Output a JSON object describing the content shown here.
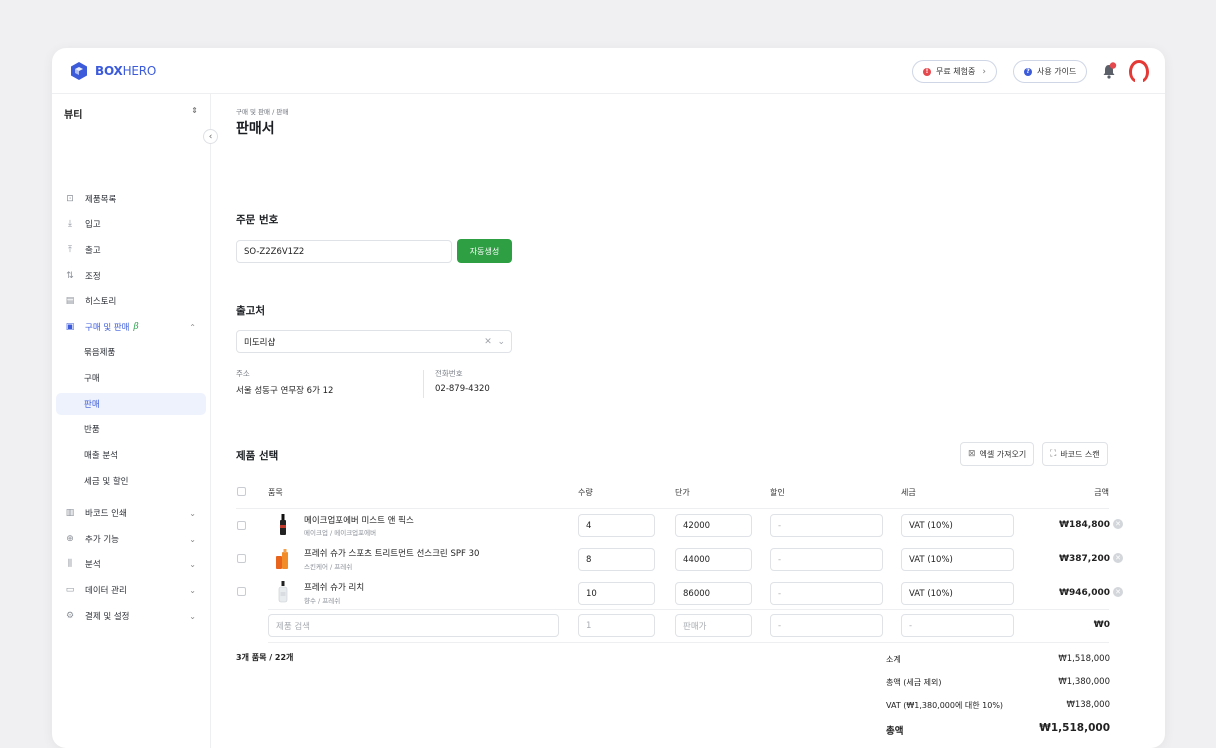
{
  "brand": {
    "name_bold": "BOX",
    "name_light": "HERO",
    "accent": "#3b5bdb"
  },
  "header": {
    "trial_label": "무료 체험중",
    "guide_label": "사용 가이드",
    "notif_count": "1"
  },
  "sidebar": {
    "workspace": "뷰티",
    "items": [
      {
        "label": "제품목록",
        "icon": "box-icon"
      },
      {
        "label": "입고",
        "icon": "arrow-down-icon"
      },
      {
        "label": "출고",
        "icon": "arrow-up-icon"
      },
      {
        "label": "조정",
        "icon": "swap-icon"
      },
      {
        "label": "히스토리",
        "icon": "history-icon"
      },
      {
        "label": "구매 및 판매",
        "icon": "document-icon",
        "beta": "β"
      }
    ],
    "sub_items": [
      "묶음제품",
      "구매",
      "판매",
      "반품",
      "매출 분석",
      "세금 및 할인"
    ],
    "groups": [
      {
        "label": "바코드 인쇄",
        "icon": "barcode-icon"
      },
      {
        "label": "추가 기능",
        "icon": "plus-circle-icon"
      },
      {
        "label": "분석",
        "icon": "chart-icon"
      },
      {
        "label": "데이터 관리",
        "icon": "database-icon"
      },
      {
        "label": "결제 및 설정",
        "icon": "settings-icon"
      }
    ]
  },
  "page": {
    "breadcrumb": "구매 및 판매 / 판매",
    "title": "판매서",
    "order_section": "주문 번호",
    "order_number": "SO-Z2Z6V1Z2",
    "auto_generate": "자동생성",
    "dest_section": "출고처",
    "destination": "미도리샵",
    "address_label": "주소",
    "address": "서울 성동구 연무장 6가 12",
    "phone_label": "전화번호",
    "phone": "02-879-4320",
    "product_section": "제품 선택",
    "excel_import": "엑셀 가져오기",
    "barcode_scan": "바코드 스캔"
  },
  "table": {
    "headers": {
      "item": "품목",
      "qty": "수량",
      "price": "단가",
      "discount": "할인",
      "tax": "세금",
      "amount": "금액"
    },
    "rows": [
      {
        "name": "메이크업포에버 미스트 앤 픽스",
        "category": "메이크업 / 메이크업포에버",
        "qty": "4",
        "price": "42000",
        "discount": "-",
        "tax": "VAT (10%)",
        "amount": "₩184,800"
      },
      {
        "name": "프레쉬 슈가 스포츠 트리트먼트 선스크린 SPF 30",
        "category": "스킨케어 / 프레쉬",
        "qty": "8",
        "price": "44000",
        "discount": "-",
        "tax": "VAT (10%)",
        "amount": "₩387,200"
      },
      {
        "name": "프레쉬 슈가 리치",
        "category": "향수 / 프레쉬",
        "qty": "10",
        "price": "86000",
        "discount": "-",
        "tax": "VAT (10%)",
        "amount": "₩946,000"
      }
    ],
    "new_row": {
      "search_placeholder": "제품 검색",
      "qty_placeholder": "1",
      "price_placeholder": "판매가",
      "discount_placeholder": "-",
      "tax_placeholder": "-",
      "amount": "₩0"
    }
  },
  "summary": {
    "count": "3개 품목 / 22개",
    "subtotal_label": "소계",
    "subtotal": "₩1,518,000",
    "pretax_label": "총액 (세금 제외)",
    "pretax": "₩1,380,000",
    "vat_label": "VAT (₩1,380,000에 대한 10%)",
    "vat": "₩138,000",
    "total_label": "총액",
    "total": "₩1,518,000"
  }
}
